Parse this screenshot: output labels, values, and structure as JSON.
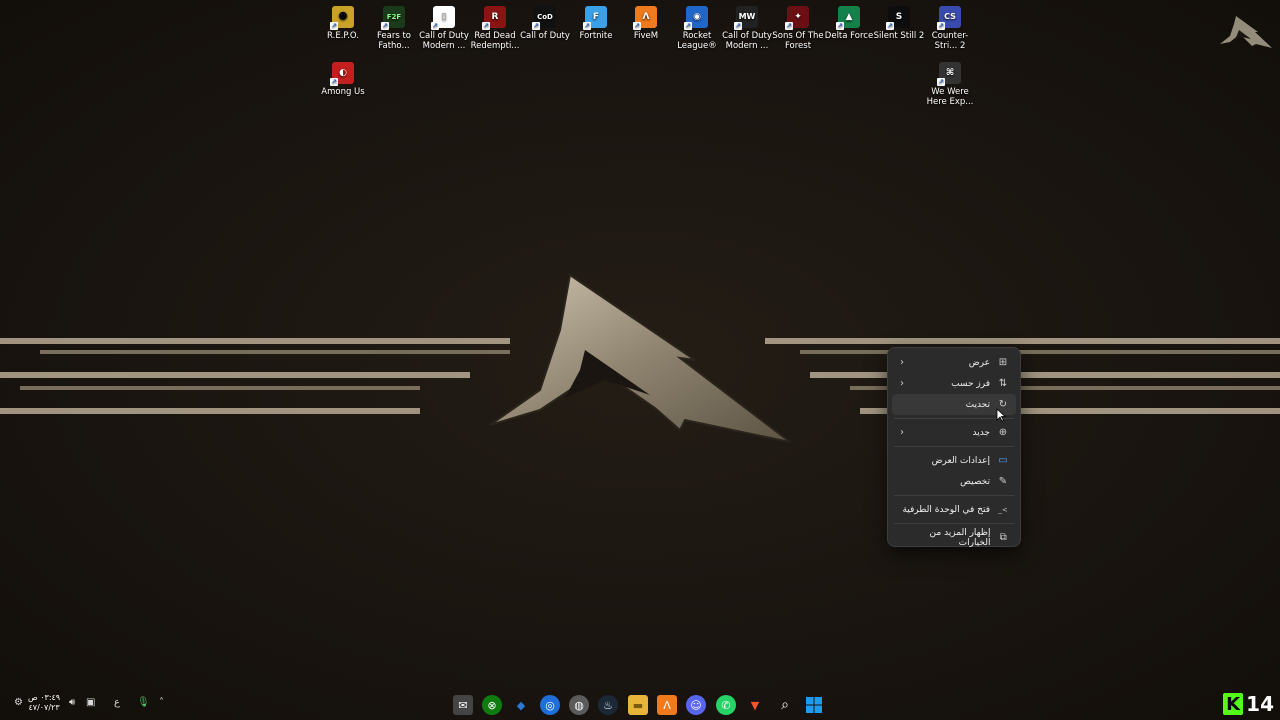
{
  "desktop": {
    "icons": [
      {
        "label": "R.E.P.O.",
        "color": "#c9a227",
        "glyph": "☻"
      },
      {
        "label": "Fears to Fatho...",
        "color": "#1b3a1b",
        "glyph": "F2F"
      },
      {
        "label": "Call of Duty Modern ...",
        "color": "#ffffff",
        "glyph": "▯"
      },
      {
        "label": "Red Dead Redempti...",
        "color": "#8a1414",
        "glyph": "R"
      },
      {
        "label": "Call of Duty",
        "color": "#111111",
        "glyph": "CoD"
      },
      {
        "label": "Fortnite",
        "color": "#3aa0e8",
        "glyph": "F"
      },
      {
        "label": "FiveM",
        "color": "#f07a1e",
        "glyph": "Λ"
      },
      {
        "label": "Rocket League®",
        "color": "#2166c9",
        "glyph": "◉"
      },
      {
        "label": "Call of Duty Modern ...",
        "color": "#222222",
        "glyph": "MW"
      },
      {
        "label": "Sons Of The Forest",
        "color": "#6b0f14",
        "glyph": "✦"
      },
      {
        "label": "Delta Force",
        "color": "#14804a",
        "glyph": "▲"
      },
      {
        "label": "Silent Still 2",
        "color": "#0d0d0d",
        "glyph": "S"
      },
      {
        "label": "Counter-Stri... 2",
        "color": "#3a4bb0",
        "glyph": "CS"
      },
      {
        "label": "Among Us",
        "color": "#c41e1e",
        "glyph": "◐"
      },
      {
        "label": "We Were Here Exp...",
        "color": "#333333",
        "glyph": "⌘"
      }
    ]
  },
  "context_menu": {
    "items": [
      {
        "label": "عرض",
        "icon": "grid-icon",
        "glyph": "⊞",
        "submenu": true
      },
      {
        "label": "فرز حسب",
        "icon": "sort-icon",
        "glyph": "⇅",
        "submenu": true
      },
      {
        "label": "تحديث",
        "icon": "refresh-icon",
        "glyph": "↻",
        "submenu": false
      },
      {
        "label": "جديد",
        "icon": "plus-circle-icon",
        "glyph": "⊕",
        "submenu": true
      },
      {
        "label": "إعدادات العرض",
        "icon": "display-icon",
        "glyph": "▭"
      },
      {
        "label": "تخصيص",
        "icon": "pencil-icon",
        "glyph": "✎"
      },
      {
        "label": "فتح في الوحدة الطرفية",
        "icon": "terminal-icon",
        "glyph": ">_"
      },
      {
        "label": "إظهار المزيد من الخيارات",
        "icon": "more-options-icon",
        "glyph": "⧉"
      }
    ],
    "chevron": "‹"
  },
  "taskbar": {
    "clock_time": "٠٣:٤٩ ص",
    "clock_date": "٤٧/٠٧/٢٣",
    "lang": "ع",
    "kick_letter": "K",
    "kick_number": "14",
    "apps": [
      {
        "name": "mail-app-icon",
        "glyph": "✉",
        "color": "#444"
      },
      {
        "name": "xbox-icon",
        "glyph": "⊗",
        "color": "#107c10"
      },
      {
        "name": "shield-app-icon",
        "glyph": "◆",
        "color": "#2a7ad8"
      },
      {
        "name": "browser-app-icon",
        "glyph": "◎",
        "color": "#1e6fd9"
      },
      {
        "name": "recorder-app-icon",
        "glyph": "◍",
        "color": "#5b5b5b"
      },
      {
        "name": "steam-icon",
        "glyph": "♨",
        "color": "#1b2838"
      },
      {
        "name": "file-explorer-icon",
        "glyph": "▬",
        "color": "#e8b53a"
      },
      {
        "name": "fivem-taskbar-icon",
        "glyph": "Λ",
        "color": "#f07a1e"
      },
      {
        "name": "discord-icon",
        "glyph": "☺",
        "color": "#5865f2"
      },
      {
        "name": "whatsapp-icon",
        "glyph": "✆",
        "color": "#25d366"
      },
      {
        "name": "brave-icon",
        "glyph": "▼",
        "color": "#fb542b"
      },
      {
        "name": "search-icon",
        "glyph": "⌕",
        "color": "transparent"
      },
      {
        "name": "windows-start-icon",
        "glyph": "⊞",
        "color": "#1a9cf0"
      }
    ]
  }
}
